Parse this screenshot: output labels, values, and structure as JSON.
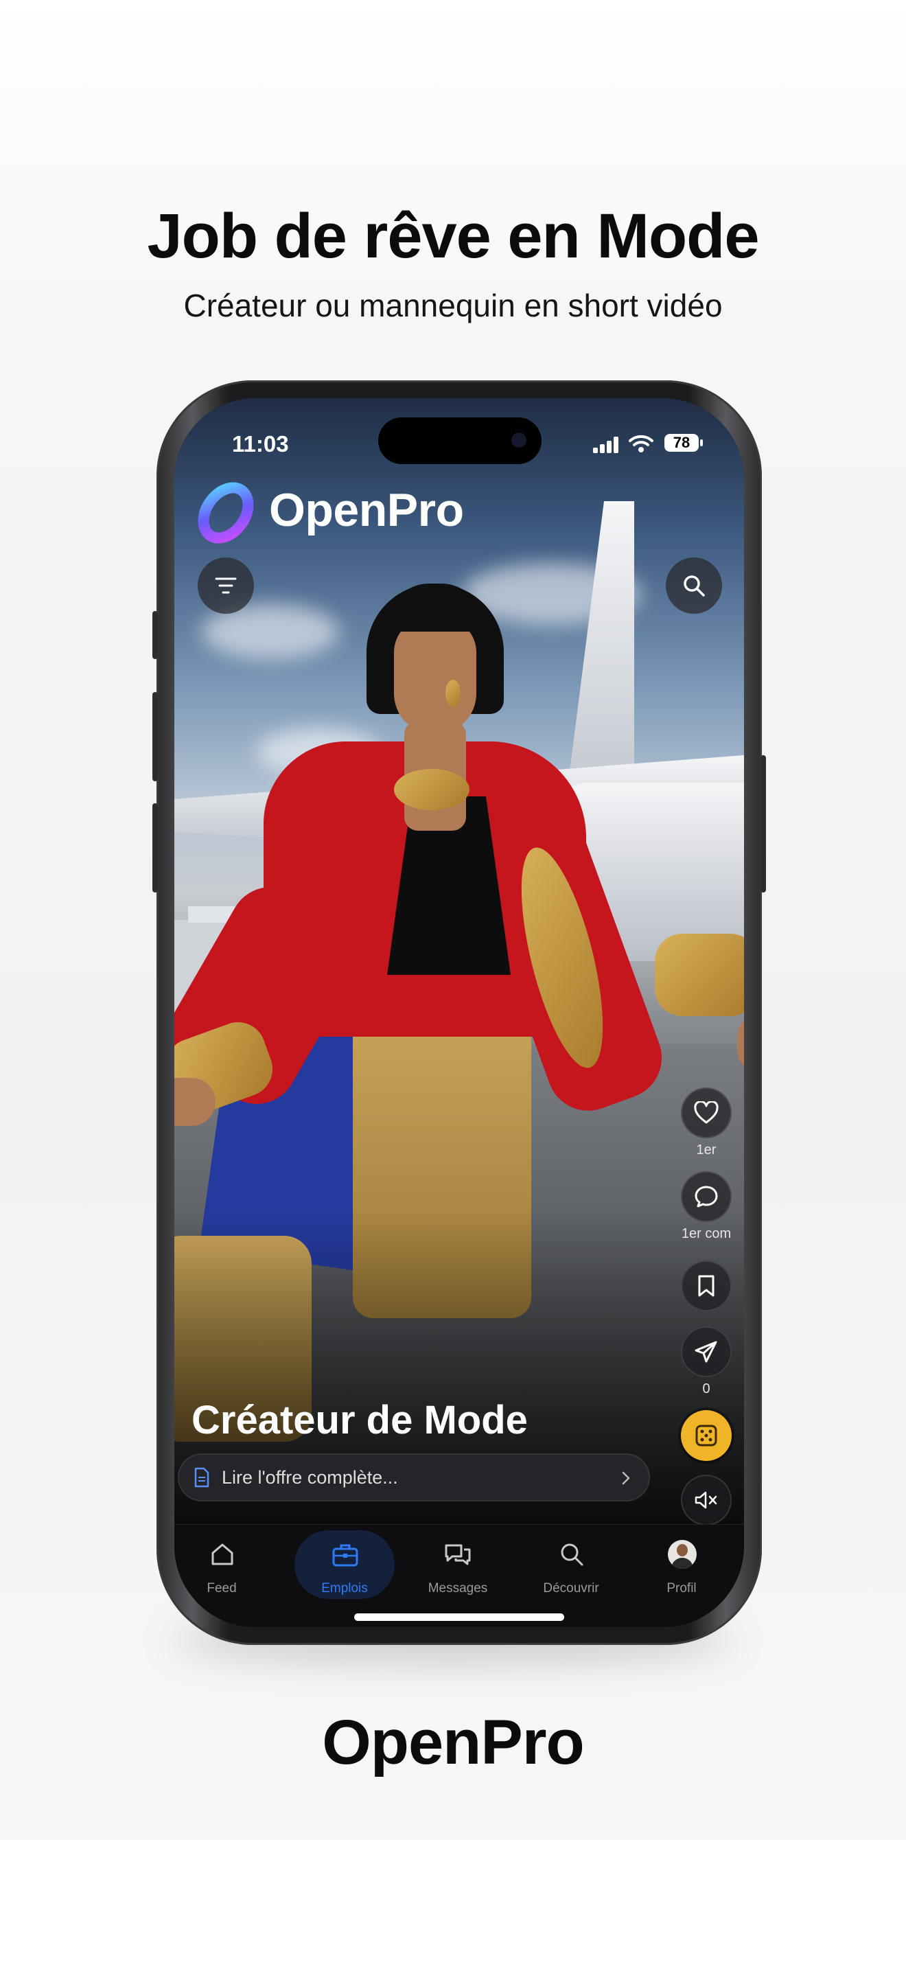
{
  "promo": {
    "headline": "Job de rêve en Mode",
    "subheadline": "Créateur ou mannequin en short vidéo",
    "footer_brand": "OpenPro"
  },
  "status_bar": {
    "time": "11:03",
    "battery": "78"
  },
  "app": {
    "brand_name": "OpenPro",
    "filter_icon": "filter-lines-icon",
    "search_icon": "search-icon"
  },
  "post": {
    "title": "Créateur de Mode",
    "read_more": "Lire l'offre complète...",
    "actions": {
      "like_count": "1er",
      "comment_count": "1er com",
      "share_count": "0"
    }
  },
  "bottom_nav": {
    "items": [
      {
        "label": "Feed",
        "icon": "home-icon"
      },
      {
        "label": "Emplois",
        "icon": "briefcase-icon"
      },
      {
        "label": "Messages",
        "icon": "chat-bubbles-icon"
      },
      {
        "label": "Découvrir",
        "icon": "search-icon"
      },
      {
        "label": "Profil",
        "icon": "avatar-icon"
      }
    ],
    "active_label": "Emplois"
  },
  "colors": {
    "accent": "#2f7bf5",
    "jacket_red": "#c4161c",
    "gold": "#f0b429"
  }
}
